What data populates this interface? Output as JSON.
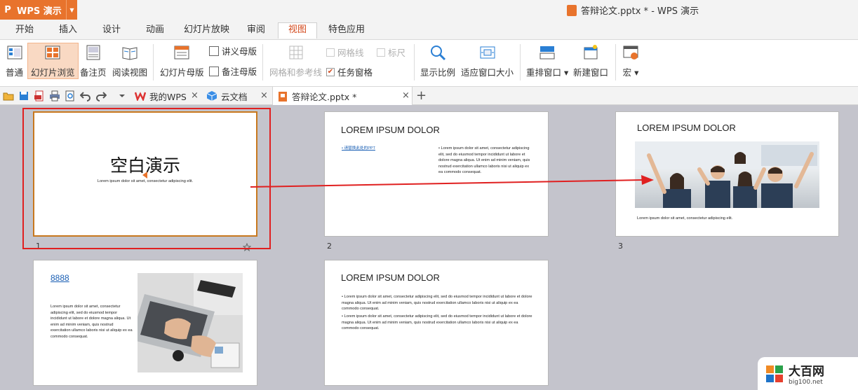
{
  "app": {
    "logo_letter": "P",
    "name": "WPS 演示",
    "window_title": "答辩论文.pptx * - WPS 演示"
  },
  "menu": {
    "tabs": [
      "开始",
      "插入",
      "设计",
      "动画",
      "幻灯片放映",
      "审阅",
      "视图",
      "特色应用"
    ],
    "active": "视图"
  },
  "ribbon": {
    "normal": "普通",
    "slide_sorter": "幻灯片浏览",
    "notes_page": "备注页",
    "reading_view": "阅读视图",
    "slide_master": "幻灯片母版",
    "handout_master": "讲义母版",
    "notes_master": "备注母版",
    "gridlines": "网格线",
    "ruler": "标尺",
    "grid_guides": "网格和参考线",
    "task_pane": "任务窗格",
    "zoom": "显示比例",
    "fit_window": "适应窗口大小",
    "arrange": "重排窗口",
    "new_window": "新建窗口",
    "macro": "宏"
  },
  "doctabs": {
    "my_wps": "我的WPS",
    "cloud": "云文档",
    "current": "答辩论文.pptx *"
  },
  "slides": {
    "s1": {
      "number": "1",
      "title": "空白演示",
      "subtitle": "Lorem ipsum dolor sit amet, consectetur adipiscing elit."
    },
    "s2": {
      "number": "2",
      "title": "LOREM IPSUM DOLOR",
      "link": "请替换此处的PPT",
      "body": "Lorem ipsum dolor sit amet, consectetur adipiscing elit, sed do eiusmod tempor incididunt ut labore et dolore magna aliqua. Ut enim ad minim veniam, quis nostrud exercitation ullamco laboris nisi ut aliquip ex ea commodo consequat."
    },
    "s3": {
      "number": "3",
      "title": "LOREM IPSUM DOLOR",
      "caption": "Lorem ipsum dolor sit amet, consectetur adipiscing elit."
    },
    "s4": {
      "title": "8888",
      "body": "Lorem ipsum dolor sit amet, consectetur adipiscing elit, sed do eiusmod tempor incididunt ut labore et dolore magna aliqua. Ut enim ad minim veniam, quis nostrud exercitation ullamco laboris nisi ut aliquip ex ea commodo consequat."
    },
    "s5": {
      "title": "LOREM IPSUM DOLOR",
      "bullet1": "Lorem ipsum dolor sit amet, consectetur adipiscing elit, sed do eiusmod tempor incididunt ut labore et dolore magna aliqua. Ut enim ad minim veniam, quis nostrud exercitation ullamco laboris nisi ut aliquip ex ea commodo consequat.",
      "bullet2": "Lorem ipsum dolor sit amet, consectetur adipiscing elit, sed do eiusmod tempor incididunt ut labore et dolore magna aliqua. Ut enim ad minim veniam, quis nostrud exercitation ullamco laboris nisi ut aliquip ex ea commodo consequat."
    }
  },
  "watermark": {
    "text": "大百网",
    "url": "big100.net"
  },
  "colors": {
    "accent": "#e8732c",
    "active_tab_text": "#d34a1d",
    "highlight_box": "#e02020",
    "arrow": "#e02020"
  }
}
